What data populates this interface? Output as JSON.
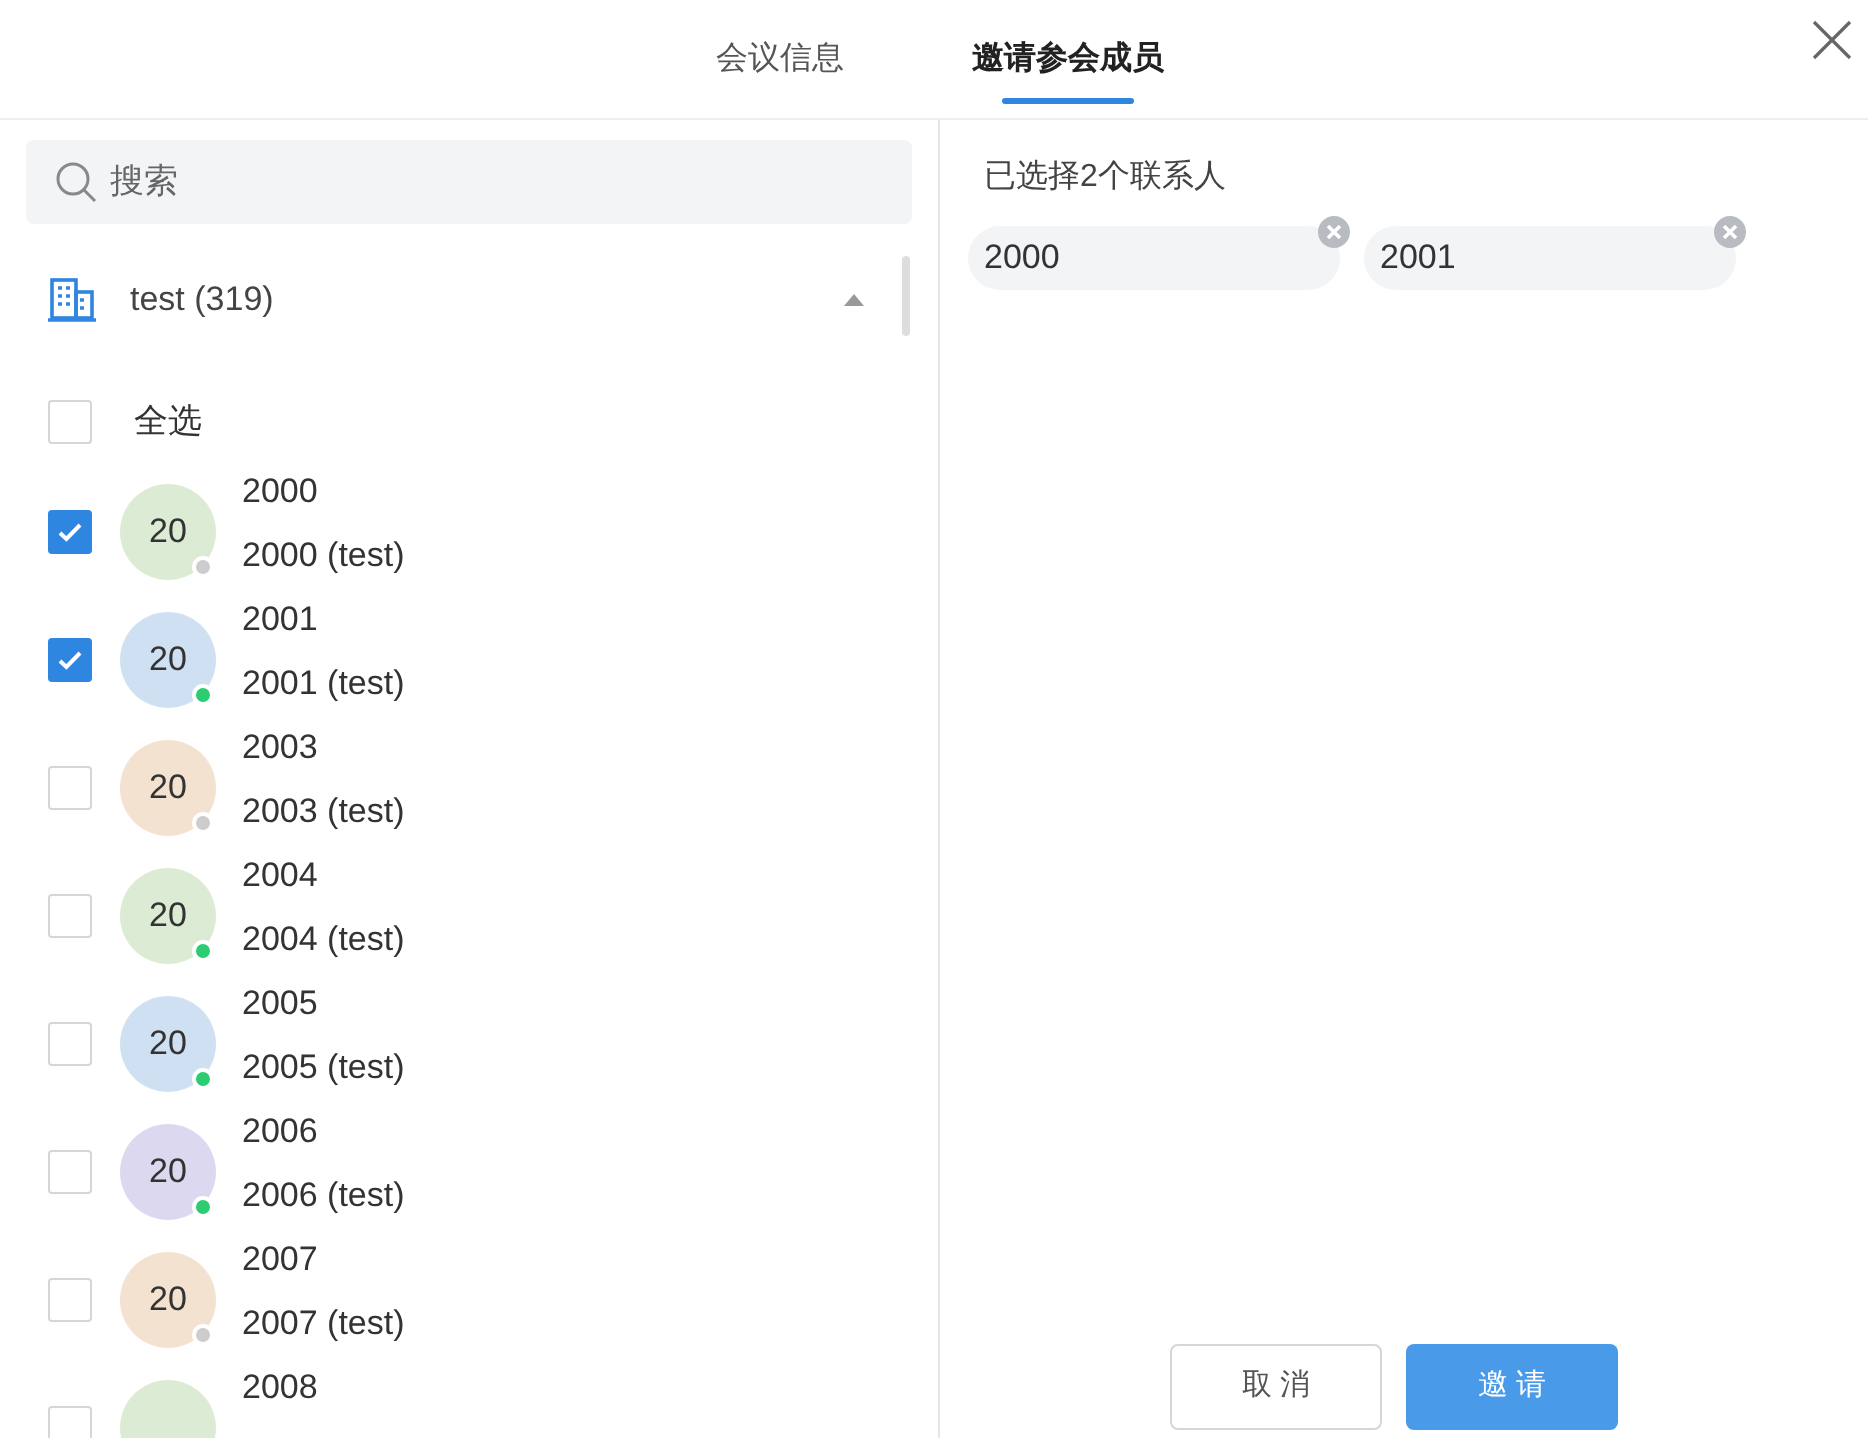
{
  "tabs": [
    {
      "label": "会议信息",
      "selected": false
    },
    {
      "label": "邀请参会成员",
      "selected": true
    }
  ],
  "search": {
    "placeholder": "搜索"
  },
  "group": {
    "label": "test (319)",
    "expanded": true
  },
  "select_all": {
    "label": "全选",
    "checked": false
  },
  "contacts": [
    {
      "name": "2000",
      "subtitle": "2000 (test)",
      "avatar_text": "20",
      "color": "#dcebd3",
      "online": false,
      "checked": true
    },
    {
      "name": "2001",
      "subtitle": "2001 (test)",
      "avatar_text": "20",
      "color": "#cfe0f2",
      "online": true,
      "checked": true
    },
    {
      "name": "2003",
      "subtitle": "2003 (test)",
      "avatar_text": "20",
      "color": "#f3e2cf",
      "online": false,
      "checked": false
    },
    {
      "name": "2004",
      "subtitle": "2004 (test)",
      "avatar_text": "20",
      "color": "#dcebd3",
      "online": true,
      "checked": false
    },
    {
      "name": "2005",
      "subtitle": "2005 (test)",
      "avatar_text": "20",
      "color": "#cfe0f2",
      "online": true,
      "checked": false
    },
    {
      "name": "2006",
      "subtitle": "2006 (test)",
      "avatar_text": "20",
      "color": "#dcd8f0",
      "online": true,
      "checked": false
    },
    {
      "name": "2007",
      "subtitle": "2007 (test)",
      "avatar_text": "20",
      "color": "#f3e2cf",
      "online": false,
      "checked": false
    },
    {
      "name": "2008",
      "color": "#dcebd3",
      "checked": false
    }
  ],
  "selected_heading": "已选择2个联系人",
  "selected_chips": [
    "2000",
    "2001"
  ],
  "buttons": {
    "cancel": "取 消",
    "invite": "邀 请"
  }
}
